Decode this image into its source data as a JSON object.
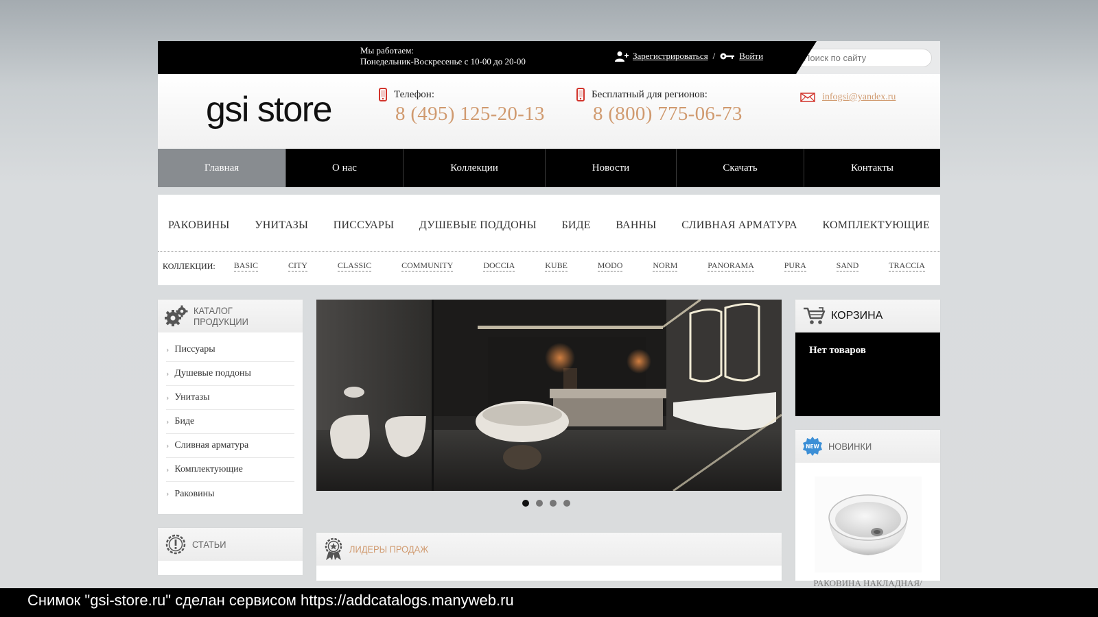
{
  "topbar": {
    "hours_line1": "Мы работаем:",
    "hours_line2": "Понедельник-Воскресенье с 10-00 до 20-00",
    "register_label": "Зарегистрироваться",
    "separator": "/",
    "login_label": "Войти",
    "search_placeholder": "Поиск по сайту"
  },
  "header": {
    "logo": "gsi store",
    "phone_label": "Телефон:",
    "phone_number": "8 (495) 125-20-13",
    "free_label": "Бесплатный для регионов:",
    "free_number": "8 (800) 775-06-73",
    "email": "infogsi@yandex.ru"
  },
  "nav": {
    "items": [
      "Главная",
      "О нас",
      "Коллекции",
      "Новости",
      "Скачать",
      "Контакты"
    ]
  },
  "categories": {
    "items": [
      "РАКОВИНЫ",
      "УНИТАЗЫ",
      "ПИССУАРЫ",
      "ДУШЕВЫЕ ПОДДОНЫ",
      "БИДЕ",
      "ВАННЫ",
      "СЛИВНАЯ АРМАТУРА",
      "КОМПЛЕКТУЮЩИЕ"
    ],
    "collections_label": "КОЛЛЕКЦИИ:",
    "collections": [
      "BASIC",
      "CITY",
      "CLASSIC",
      "COMMUNITY",
      "DOCCIA",
      "KUBE",
      "MODO",
      "NORM",
      "PANORAMA",
      "PURA",
      "SAND",
      "TRACCIA"
    ]
  },
  "catalog": {
    "title_line1": "КАТАЛОГ",
    "title_line2": "ПРОДУКЦИИ",
    "items": [
      "Писсуары",
      "Душевые поддоны",
      "Унитазы",
      "Биде",
      "Сливная арматура",
      "Комплектующие",
      "Раковины"
    ]
  },
  "articles": {
    "title": "СТАТЬИ"
  },
  "leaders": {
    "title": "ЛИДЕРЫ ПРОДАЖ"
  },
  "cart": {
    "title": "КОРЗИНА",
    "empty_text": "Нет товаров"
  },
  "new_items": {
    "title": "НОВИНКИ",
    "badge": "NEW",
    "product_name": "РАКОВИНА НАКЛАДНАЯ/"
  },
  "slider": {
    "slide_count": 4,
    "active_slide": 1
  },
  "caption": "Снимок \"gsi-store.ru\" сделан сервисом https://addcatalogs.manyweb.ru",
  "colors": {
    "accent": "#d09a6f",
    "nav_bg": "#000000",
    "nav_active": "#888c90"
  }
}
